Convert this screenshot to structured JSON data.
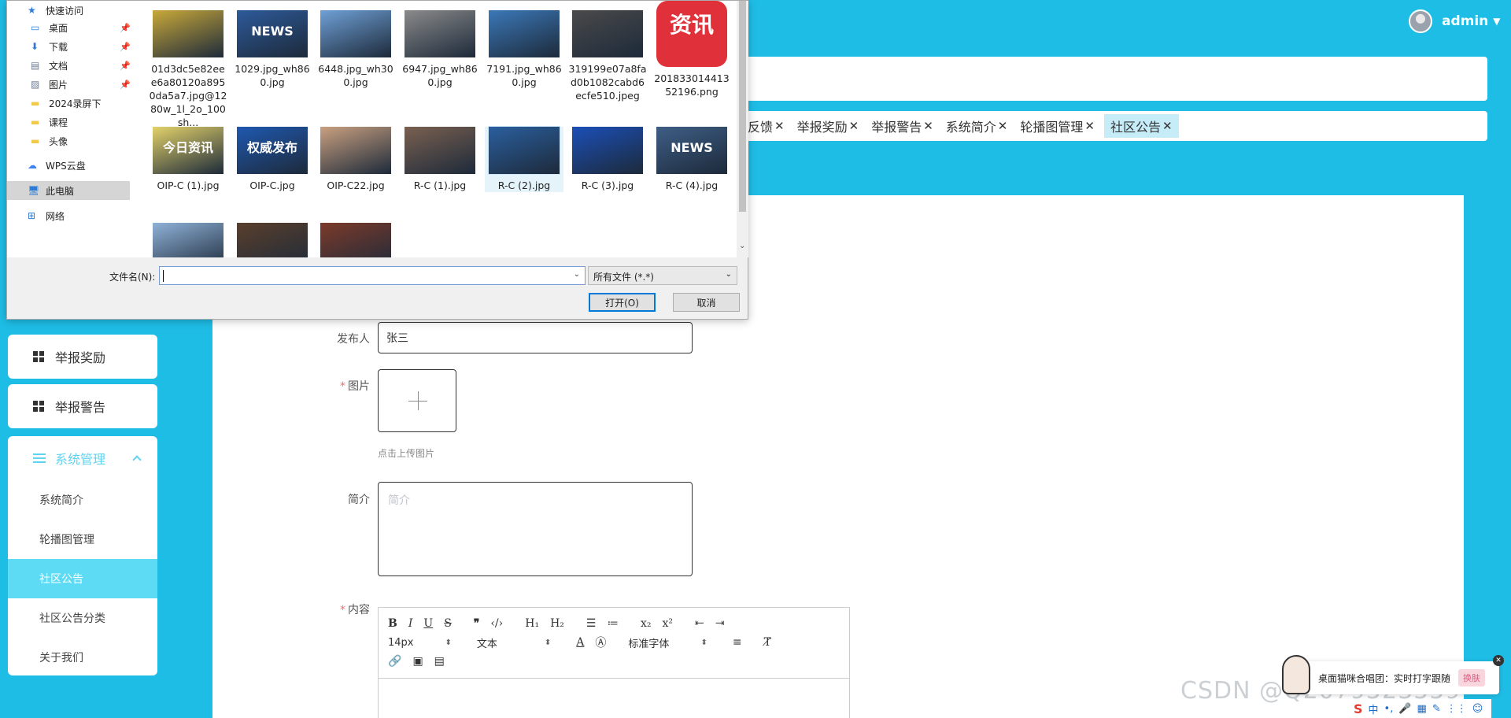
{
  "header": {
    "username": "admin"
  },
  "tabs": [
    {
      "label": "反馈"
    },
    {
      "label": "举报奖励"
    },
    {
      "label": "举报警告"
    },
    {
      "label": "系统简介"
    },
    {
      "label": "轮播图管理"
    },
    {
      "label": "社区公告",
      "active": true
    }
  ],
  "sidebar": {
    "cards": [
      {
        "label": "举报奖励"
      },
      {
        "label": "举报警告"
      }
    ],
    "group": {
      "title": "系统管理",
      "items": [
        {
          "label": "系统简介"
        },
        {
          "label": "轮播图管理"
        },
        {
          "label": "社区公告",
          "active": true
        },
        {
          "label": "社区公告分类"
        },
        {
          "label": "关于我们"
        }
      ]
    }
  },
  "form": {
    "publisher_label": "发布人",
    "publisher_value": "张三",
    "image_label": "图片",
    "upload_hint": "点击上传图片",
    "summary_label": "简介",
    "summary_placeholder": "简介",
    "content_label": "内容",
    "editor": {
      "font_size": "14px",
      "block_type": "文本",
      "font_family": "标准字体"
    }
  },
  "file_dialog": {
    "nav": [
      {
        "label": "快速访问",
        "icon": "star-icon"
      },
      {
        "label": "桌面",
        "icon": "desktop-icon",
        "pinned": true
      },
      {
        "label": "下载",
        "icon": "download-icon",
        "pinned": true
      },
      {
        "label": "文档",
        "icon": "document-icon",
        "pinned": true
      },
      {
        "label": "图片",
        "icon": "picture-icon",
        "pinned": true
      },
      {
        "label": "2024录屏下",
        "icon": "folder-icon"
      },
      {
        "label": "课程",
        "icon": "folder-icon"
      },
      {
        "label": "头像",
        "icon": "folder-icon"
      },
      {
        "label": "WPS云盘",
        "icon": "cloud-icon"
      },
      {
        "label": "此电脑",
        "icon": "computer-icon",
        "selected": true
      },
      {
        "label": "网络",
        "icon": "network-icon"
      }
    ],
    "files": [
      {
        "name": "01d3dc5e82eee6a80120a8950da5a7.jpg@1280w_1l_2o_100sh...",
        "color": "#c9a93a"
      },
      {
        "name": "1029.jpg_wh860.jpg",
        "color": "#2d5a9a"
      },
      {
        "name": "6448.jpg_wh300.jpg",
        "color": "#6fa0d6"
      },
      {
        "name": "6947.jpg_wh860.jpg",
        "color": "#8a8a8a"
      },
      {
        "name": "7191.jpg_wh860.jpg",
        "color": "#3b78b8"
      },
      {
        "name": "319199e07a8fad0b1082cabd6ecfe510.jpeg",
        "color": "#4a4a4a"
      },
      {
        "name": "20183301441352196.png",
        "color": "#e0313a"
      },
      {
        "name": "OIP-C (1).jpg",
        "color": "#e3d26a"
      },
      {
        "name": "OIP-C.jpg",
        "color": "#1f58b0"
      },
      {
        "name": "OIP-C22.jpg",
        "color": "#c9a080"
      },
      {
        "name": "R-C (1).jpg",
        "color": "#7a6050"
      },
      {
        "name": "R-C (2).jpg",
        "color": "#2a5f9e"
      },
      {
        "name": "R-C (3).jpg",
        "color": "#1b4fb8"
      },
      {
        "name": "R-C (4).jpg",
        "color": "#3e5e86"
      },
      {
        "name": "",
        "color": "#8fb2d8"
      },
      {
        "name": "",
        "color": "#5a3f2c"
      },
      {
        "name": "",
        "color": "#7c3a2a"
      }
    ],
    "thumb_text": {
      "news": "NEWS",
      "zixun": "资讯",
      "quanwei": "权威发布",
      "jinri": "今日资讯",
      "news2": "NEWS"
    },
    "filename_label": "文件名(N):",
    "filename_value": "",
    "filter_value": "所有文件 (*.*)",
    "open_button": "打开(O)",
    "cancel_button": "取消"
  },
  "overlay": {
    "watermark": "CSDN @Q2079523559",
    "notify_text": "桌面猫咪合唱团：实时打字跟随",
    "notify_button": "换肤",
    "ime_items": [
      "S",
      "中",
      "•,",
      "🎤",
      "▦",
      "✎",
      "⋮⋮",
      "☺"
    ]
  }
}
